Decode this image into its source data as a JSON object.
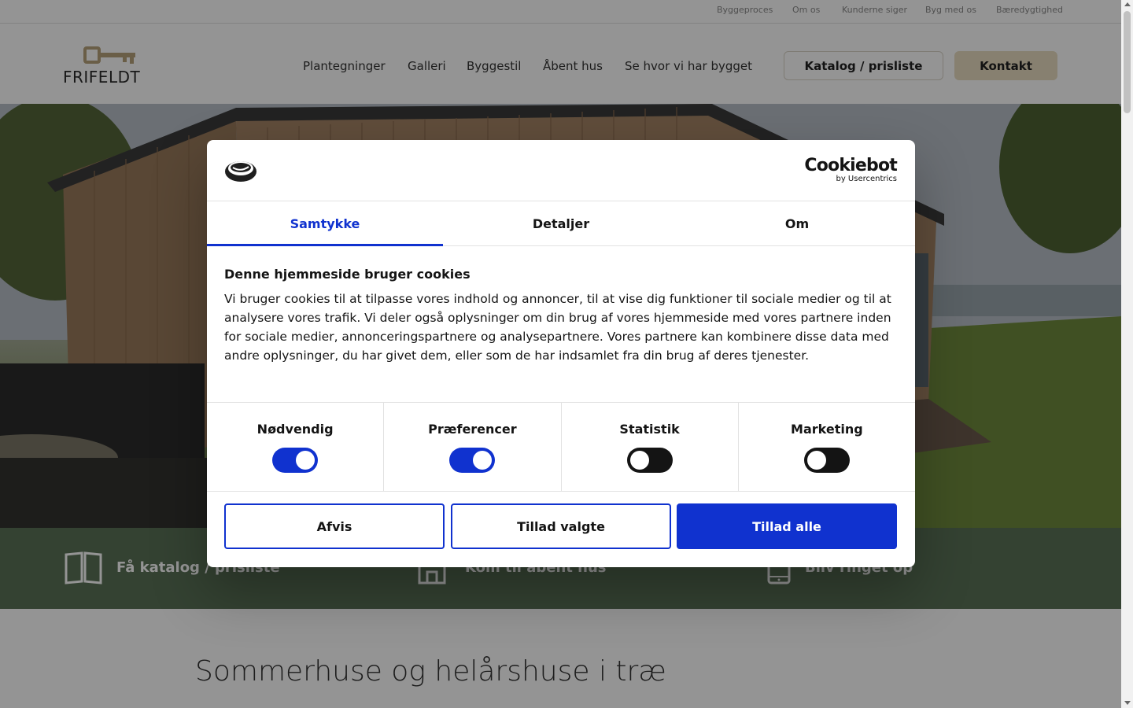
{
  "topbar": {
    "links": [
      "Byggeproces",
      "Om os",
      "Kunderne siger",
      "Byg med os",
      "Bæredygtighed"
    ]
  },
  "header": {
    "logo_text": "FRIFELDT",
    "nav": [
      "Plantegninger",
      "Galleri",
      "Byggestil",
      "Åbent hus",
      "Se hvor vi har bygget"
    ],
    "catalog_button": "Katalog / prisliste",
    "contact_button": "Kontakt"
  },
  "ribbon": {
    "items": [
      "Få katalog / prisliste",
      "Kom til åbent hus",
      "Bliv ringet op"
    ]
  },
  "section": {
    "title": "Sommerhuse og helårshuse i træ"
  },
  "dialog": {
    "brand_name": "Cookiebot",
    "brand_sub": "by Usercentrics",
    "tabs": [
      "Samtykke",
      "Detaljer",
      "Om"
    ],
    "active_tab": "Samtykke",
    "heading": "Denne hjemmeside bruger cookies",
    "text": "Vi bruger cookies til at tilpasse vores indhold og annoncer, til at vise dig funktioner til sociale medier og til at analysere vores trafik. Vi deler også oplysninger om din brug af vores hjemmeside med vores partnere inden for sociale medier, annonceringspartnere og analysepartnere. Vores partnere kan kombinere disse data med andre oplysninger, du har givet dem, eller som de har indsamlet fra din brug af deres tjenester.",
    "toggles": [
      {
        "label": "Nødvendig",
        "on": true
      },
      {
        "label": "Præferencer",
        "on": true
      },
      {
        "label": "Statistik",
        "on": false
      },
      {
        "label": "Marketing",
        "on": false
      }
    ],
    "buttons": {
      "reject": "Afvis",
      "allow_selected": "Tillad valgte",
      "allow_all": "Tillad alle"
    },
    "accent_color": "#1032cf"
  },
  "colors": {
    "ribbon": "#5a7356",
    "contact_button": "#e8dcc2",
    "logo_gold": "#b7a27a"
  }
}
